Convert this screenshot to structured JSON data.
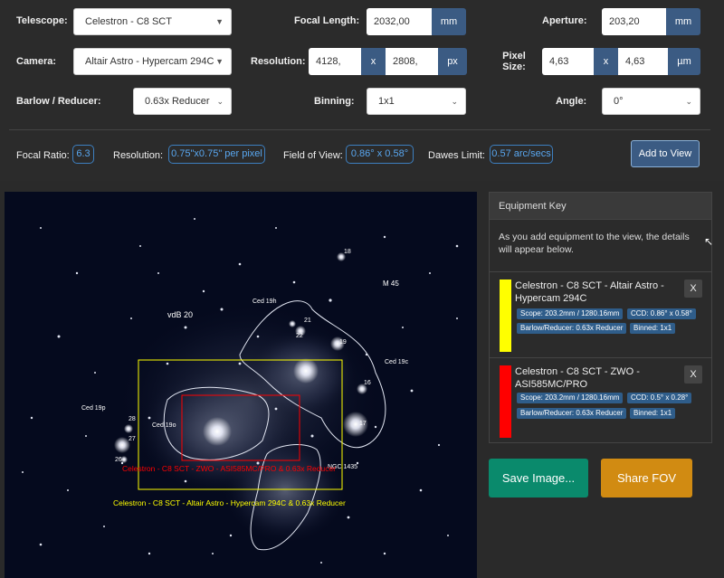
{
  "form": {
    "telescope_label": "Telescope:",
    "telescope_value": "Celestron - C8 SCT",
    "focal_length_label": "Focal Length:",
    "focal_length_value": "2032,00",
    "focal_length_unit": "mm",
    "aperture_label": "Aperture:",
    "aperture_value": "203,20",
    "aperture_unit": "mm",
    "camera_label": "Camera:",
    "camera_value": "Altair Astro - Hypercam 294C",
    "resolution_label": "Resolution:",
    "resolution_x": "4128,",
    "resolution_sep": "x",
    "resolution_y": "2808,",
    "resolution_unit": "px",
    "pixel_size_label": "Pixel Size:",
    "pixel_x": "4,63",
    "pixel_sep": "x",
    "pixel_y": "4,63",
    "pixel_unit": "µm",
    "barlow_label": "Barlow / Reducer:",
    "barlow_value": "0.63x Reducer",
    "binning_label": "Binning:",
    "binning_value": "1x1",
    "angle_label": "Angle:",
    "angle_value": "0°"
  },
  "stats": {
    "focal_ratio_label": "Focal Ratio:",
    "focal_ratio_value": "6.3",
    "resolution_label": "Resolution:",
    "resolution_value": "0.75\"x0.75\" per pixel",
    "fov_label": "Field of View:",
    "fov_value": "0.86° x 0.58°",
    "dawes_label": "Dawes Limit:",
    "dawes_value": "0.57 arc/secs",
    "add_button": "Add to View"
  },
  "sky": {
    "labels": [
      "18",
      "M 45",
      "Ced 19h",
      "vdB 20",
      "21",
      "22",
      "19",
      "Ced 19c",
      "16",
      "28",
      "27",
      "Ced 19p",
      "Ced 19o",
      "17",
      "26",
      "NGC 1435"
    ],
    "fov_red_label": "Celestron - C8 SCT - ZWO - ASI585MC/PRO  & 0.63x Reducer",
    "fov_yellow_label": "Celestron - C8 SCT - Altair Astro - Hypercam 294C  & 0.63x Reducer"
  },
  "key": {
    "header": "Equipment Key",
    "intro": "As you add equipment to the view, the details will appear below.",
    "entries": [
      {
        "color": "#ffff00",
        "title": "Celestron - C8 SCT - Altair Astro - Hypercam 294C",
        "scope": "Scope: 203.2mm / 1280.16mm",
        "ccd": "CCD: 0.86° x 0.58°",
        "barlow": "Barlow/Reducer: 0.63x Reducer",
        "binned": "Binned: 1x1",
        "close": "X"
      },
      {
        "color": "#ff0000",
        "title": "Celestron - C8 SCT - ZWO - ASI585MC/PRO",
        "scope": "Scope: 203.2mm / 1280.16mm",
        "ccd": "CCD: 0.5° x 0.28°",
        "barlow": "Barlow/Reducer: 0.63x Reducer",
        "binned": "Binned: 1x1",
        "close": "X"
      }
    ]
  },
  "actions": {
    "save": "Save Image...",
    "share": "Share FOV"
  },
  "colors": {
    "accent": "#3b5b83",
    "save": "#0a8a6c",
    "share": "#d18b12",
    "fov_yellow": "#ffff00",
    "fov_red": "#ff0000"
  }
}
